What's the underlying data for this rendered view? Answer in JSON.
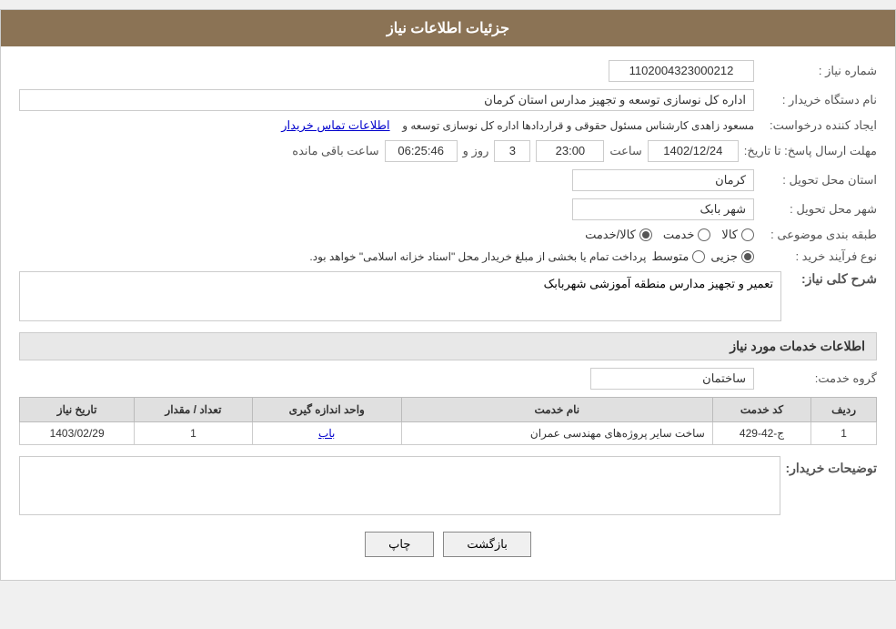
{
  "header": {
    "title": "جزئیات اطلاعات نیاز"
  },
  "fields": {
    "shomareNiaz_label": "شماره نیاز :",
    "shomareNiaz_value": "1102004323000212",
    "namDastgah_label": "نام دستگاه خریدار :",
    "namDastgah_value": "اداره کل نوسازی  توسعه و تجهیز مدارس استان کرمان",
    "ijanadKonandeLabel": "ایجاد کننده درخواست:",
    "ijandKonande_text1": "مسعود زاهدی کارشناس مسئول حقوقی و قراردادها اداره کل نوسازی  توسعه و",
    "ijandKonande_link": "اطلاعات تماس خریدار",
    "mohlat_label": "مهلت ارسال پاسخ: تا تاریخ:",
    "mohlat_date": "1402/12/24",
    "mohlat_time_label": "ساعت",
    "mohlat_time": "23:00",
    "mohlat_roz_label": "روز و",
    "mohlat_roz": "3",
    "mohlat_remaining_label": "ساعت باقی مانده",
    "mohlat_remaining": "06:25:46",
    "ostan_label": "استان محل تحویل :",
    "ostan_value": "کرمان",
    "shahr_label": "شهر محل تحویل :",
    "shahr_value": "شهر بابک",
    "tabaqe_label": "طبقه بندی موضوعی :",
    "radio_kala": "کالا",
    "radio_khedmat": "خدمت",
    "radio_kala_khedmat": "کالا/خدمت",
    "radio_kala_khedmat_selected": true,
    "noe_label": "نوع فرآیند خرید :",
    "radio_jazii": "جزیی",
    "radio_motavasset": "متوسط",
    "radio_jazii_selected": true,
    "process_note": "پرداخت تمام یا بخشی از مبلغ خریدار محل \"اسناد خزانه اسلامی\" خواهد بود.",
    "sharh_label": "شرح کلی نیاز:",
    "sharh_value": "تعمیر و تجهیز مدارس منطقه آموزشی شهربابک",
    "khadamat_section": "اطلاعات خدمات مورد نیاز",
    "group_label": "گروه خدمت:",
    "group_value": "ساختمان",
    "table_headers": {
      "radif": "ردیف",
      "kod": "کد خدمت",
      "service_name": "نام خدمت",
      "vahed": "واحد اندازه گیری",
      "tedad": "تعداد / مقدار",
      "tarikh": "تاریخ نیاز"
    },
    "table_rows": [
      {
        "radif": "1",
        "kod": "ج-42-429",
        "service_name": "ساخت سایر پروژه‌های مهندسی عمران",
        "vahed": "باب",
        "tedad": "1",
        "tarikh": "1403/02/29"
      }
    ],
    "towzihat_label": "توضیحات خریدار:",
    "towzihat_value": "",
    "btn_back": "بازگشت",
    "btn_print": "چاپ"
  }
}
